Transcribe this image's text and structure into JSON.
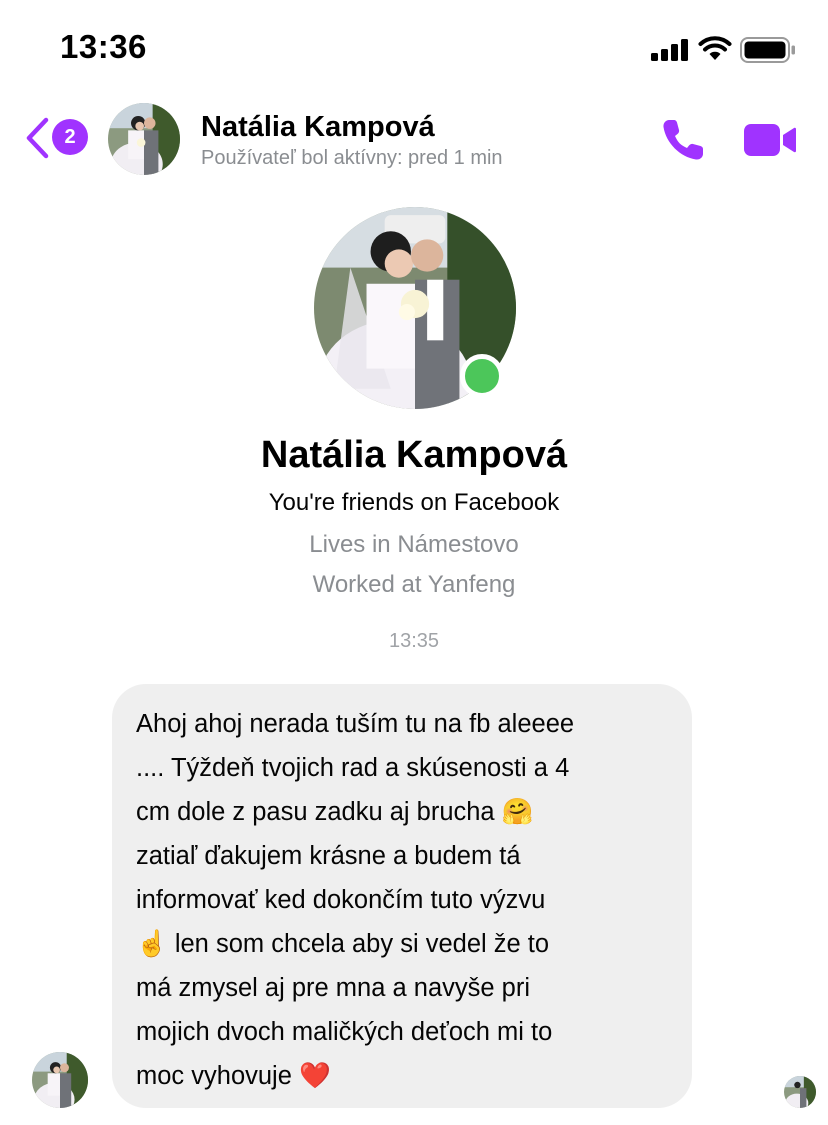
{
  "status_bar": {
    "time": "13:36",
    "icons": [
      "signal-icon",
      "wifi-icon",
      "battery-icon"
    ]
  },
  "header": {
    "back_label": "Back",
    "unread_count": "2",
    "contact_name": "Natália Kampová",
    "contact_status": "Používateľ bol aktívny: pred 1 min",
    "icons": [
      "chevron-left-icon",
      "phone-icon",
      "video-camera-icon"
    ]
  },
  "profile": {
    "name": "Natália Kampová",
    "friends_line": "You're friends on Facebook",
    "lives_line": "Lives in Námestovo",
    "worked_line": "Worked at Yanfeng",
    "online": true
  },
  "conversation": {
    "timestamp": "13:35",
    "messages": [
      {
        "from": "contact",
        "text": "Ahoj ahoj nerada tuším tu na fb aleeee\n.... Týždeň tvojich rad a skúsenosti a 4\ncm dole z pasu zadku aj brucha 🤗\nzatiaľ ďakujem krásne a budem tá\ninformovať ked dokončím tuto výzvu\n☝️ len som chcela aby si vedel že to\nmá zmysel aj pre mna a navyše pri\nmojich dvoch maličkých deťoch mi to\nmoc vyhovuje ❤️"
      }
    ]
  },
  "colors": {
    "accent": "#a033ff",
    "online": "#4cc65a",
    "bubble": "#efefef",
    "secondary_text": "#8a8d91"
  }
}
